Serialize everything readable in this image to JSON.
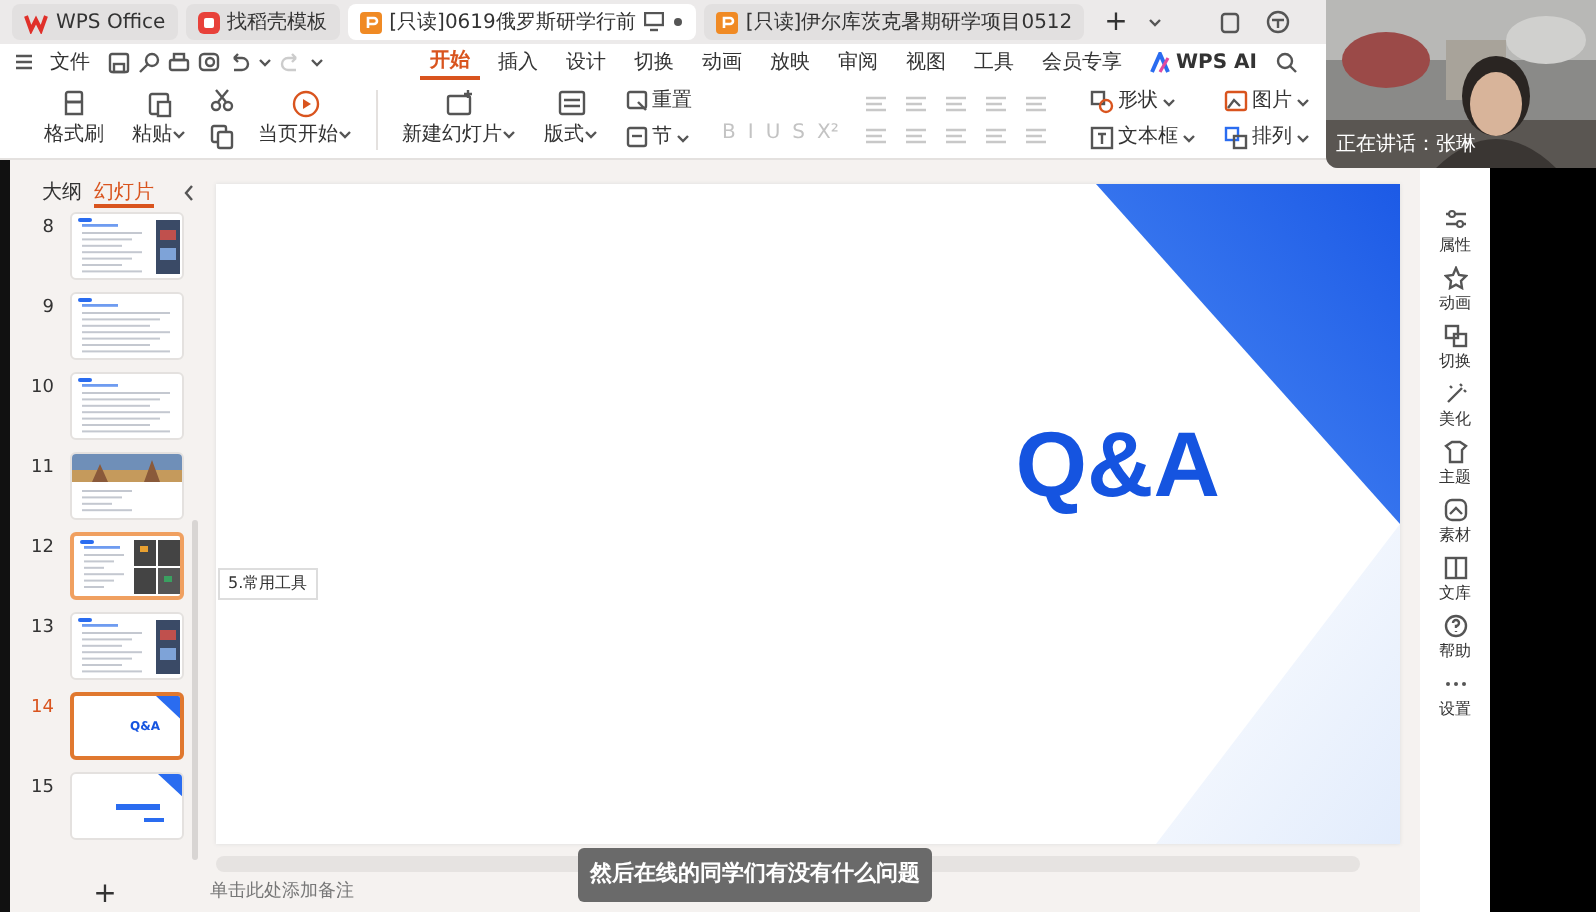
{
  "window_tabs": [
    {
      "label": "WPS Office",
      "kind": "home",
      "selected": false
    },
    {
      "label": "找稻壳模板",
      "kind": "template",
      "selected": false
    },
    {
      "label": "[只读]0619俄罗斯研学行前",
      "kind": "document",
      "selected": true
    },
    {
      "label": "[只读]伊尔库茨克暑期研学项目0512",
      "kind": "document",
      "selected": false
    }
  ],
  "new_tab": "+",
  "menu": {
    "file": "文件",
    "tabs": [
      {
        "label": "开始",
        "selected": true
      },
      {
        "label": "插入",
        "selected": false
      },
      {
        "label": "设计",
        "selected": false
      },
      {
        "label": "切换",
        "selected": false
      },
      {
        "label": "动画",
        "selected": false
      },
      {
        "label": "放映",
        "selected": false
      },
      {
        "label": "审阅",
        "selected": false
      },
      {
        "label": "视图",
        "selected": false
      },
      {
        "label": "工具",
        "selected": false
      },
      {
        "label": "会员专享",
        "selected": false
      }
    ],
    "ai": "WPS AI"
  },
  "ribbon": {
    "large_buttons": [
      {
        "label": "格式刷",
        "dropdown": false
      },
      {
        "label": "粘贴",
        "dropdown": true
      },
      {
        "label": "当页开始",
        "dropdown": true
      },
      {
        "label": "新建幻灯片",
        "dropdown": true
      },
      {
        "label": "版式",
        "dropdown": true
      }
    ],
    "small_buttons": [
      {
        "label": "重置",
        "dropdown": false
      },
      {
        "label": "节",
        "dropdown": true
      }
    ],
    "format_glyphs": [
      {
        "label": "B",
        "disabled": true
      },
      {
        "label": "I",
        "disabled": true
      },
      {
        "label": "U",
        "disabled": true
      },
      {
        "label": "S",
        "disabled": true
      },
      {
        "label": "X²",
        "disabled": true
      }
    ],
    "insert_buttons": [
      {
        "label": "形状",
        "dropdown": true
      },
      {
        "label": "文本框",
        "dropdown": true
      },
      {
        "label": "图片",
        "dropdown": true
      },
      {
        "label": "排列",
        "dropdown": true
      }
    ]
  },
  "panel": {
    "tabs": [
      {
        "label": "大纲",
        "selected": false
      },
      {
        "label": "幻灯片",
        "selected": true
      }
    ],
    "slides": [
      {
        "number": "8",
        "kind": "text_photo",
        "selected": false,
        "hovered": false
      },
      {
        "number": "9",
        "kind": "text",
        "selected": false,
        "hovered": false
      },
      {
        "number": "10",
        "kind": "text",
        "selected": false,
        "hovered": false
      },
      {
        "number": "11",
        "kind": "banner",
        "selected": false,
        "hovered": false
      },
      {
        "number": "12",
        "kind": "grid",
        "selected": false,
        "hovered": true
      },
      {
        "number": "13",
        "kind": "text_photo",
        "selected": false,
        "hovered": false
      },
      {
        "number": "14",
        "kind": "title",
        "title": "Q&A",
        "selected": true,
        "hovered": false
      },
      {
        "number": "15",
        "kind": "closing",
        "selected": false,
        "hovered": false
      }
    ],
    "tooltip": "5.常用工具",
    "add": "+"
  },
  "slide": {
    "title": "Q&A"
  },
  "notes_placeholder": "单击此处添加备注",
  "side_tools": [
    {
      "label": "属性"
    },
    {
      "label": "动画"
    },
    {
      "label": "切换"
    },
    {
      "label": "美化"
    },
    {
      "label": "主题"
    },
    {
      "label": "素材"
    },
    {
      "label": "文库"
    },
    {
      "label": "帮助"
    },
    {
      "label": "设置"
    }
  ],
  "video": {
    "speaker": "正在讲话：张琳"
  },
  "caption": "然后在线的同学们有没有什么问题"
}
